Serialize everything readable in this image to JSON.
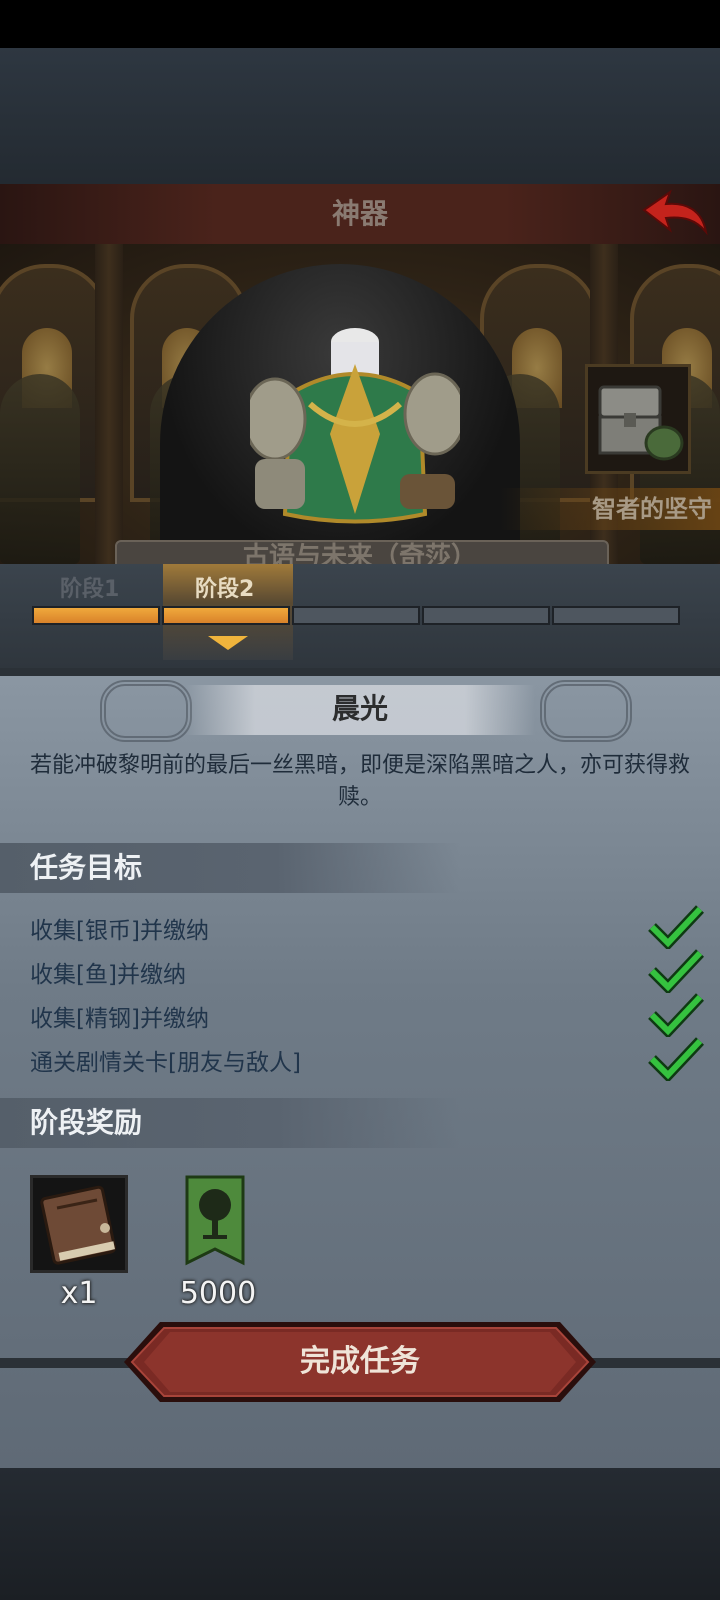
{
  "header": {
    "title": "神器",
    "back_icon": "back-arrow-icon"
  },
  "artifact": {
    "name": "古语与未来（奇莎）",
    "quest_chest_label": "智者的坚守",
    "chest_icon": "treasure-chest-icon"
  },
  "stages": {
    "items": [
      {
        "label": "阶段1",
        "completed": true
      },
      {
        "label": "阶段2",
        "completed": true,
        "selected": true
      },
      {
        "label": "",
        "completed": false
      },
      {
        "label": "",
        "completed": false
      },
      {
        "label": "",
        "completed": false
      }
    ]
  },
  "stage_detail": {
    "title": "晨光",
    "description": "若能冲破黎明前的最后一丝黑暗，即便是深陷黑暗之人，亦可获得救赎。"
  },
  "objectives": {
    "heading": "任务目标",
    "items": [
      {
        "text": "收集[银币]并缴纳",
        "done": true
      },
      {
        "text": "收集[鱼]并缴纳",
        "done": true
      },
      {
        "text": "收集[精钢]并缴纳",
        "done": true
      },
      {
        "text": "通关剧情关卡[朋友与敌人]",
        "done": true
      }
    ]
  },
  "rewards": {
    "heading": "阶段奖励",
    "items": [
      {
        "icon": "book-icon",
        "qty": "x1"
      },
      {
        "icon": "tree-banner-icon",
        "qty": "5000"
      }
    ]
  },
  "actions": {
    "complete_label": "完成任务"
  },
  "colors": {
    "accent": "#e89a35",
    "check": "#2fbf38",
    "button": "#7a2a24"
  }
}
